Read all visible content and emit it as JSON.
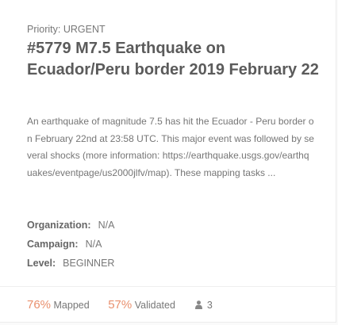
{
  "project": {
    "priority_label": "Priority:",
    "priority_value": "URGENT",
    "title": "#5779 M7.5 Earthquake on Ecuador/Peru border 2019 February 22",
    "description": "An earthquake of magnitude 7.5 has hit the Ecuador - Peru border on February 22nd at 23:58 UTC. This major event was followed by several shocks (more information: https://earthquake.usgs.gov/earthquakes/eventpage/us2000jlfv/map). These mapping tasks ...",
    "organization": {
      "label": "Organization:",
      "value": "N/A"
    },
    "campaign": {
      "label": "Campaign:",
      "value": "N/A"
    },
    "level": {
      "label": "Level:",
      "value": "BEGINNER"
    },
    "stats": {
      "mapped_percent": "76%",
      "mapped_label": "Mapped",
      "validated_percent": "57%",
      "validated_label": "Validated",
      "contributors": "3"
    }
  },
  "colors": {
    "accent": "#e9906e",
    "title": "#5b5b5b",
    "text": "#777777"
  },
  "icons": {
    "contributors": "user-icon"
  }
}
